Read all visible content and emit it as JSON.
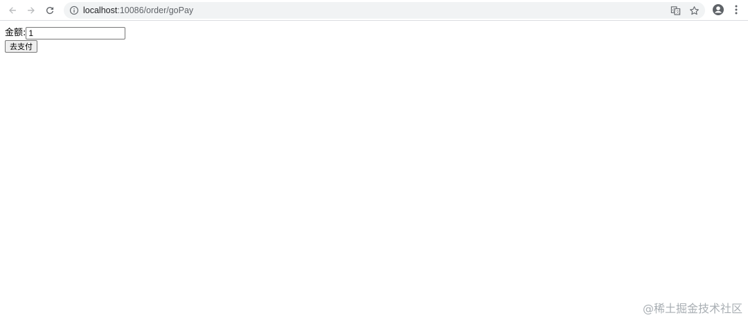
{
  "browser": {
    "url_host": "localhost",
    "url_path": ":10086/order/goPay",
    "icons": {
      "back": "arrow-left-icon",
      "forward": "arrow-right-icon",
      "reload": "reload-icon",
      "info": "info-icon",
      "translate": "translate-icon",
      "bookmark": "star-icon",
      "profile": "account-icon",
      "menu": "more-vertical-icon"
    }
  },
  "form": {
    "amount_label": "金额:",
    "amount_value": "1",
    "submit_label": "去支付"
  },
  "watermark": "@稀土掘金技术社区"
}
